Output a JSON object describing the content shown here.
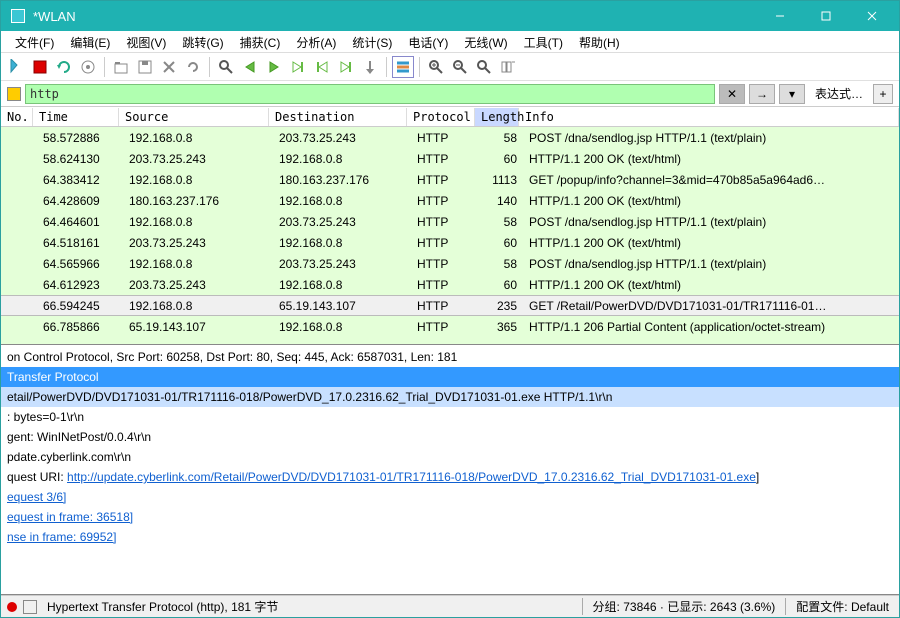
{
  "window": {
    "title": "*WLAN"
  },
  "menu": [
    "文件(F)",
    "编辑(E)",
    "视图(V)",
    "跳转(G)",
    "捕获(C)",
    "分析(A)",
    "统计(S)",
    "电话(Y)",
    "无线(W)",
    "工具(T)",
    "帮助(H)"
  ],
  "filter": {
    "value": "http",
    "expr_label": "表达式…"
  },
  "columns": [
    "No.",
    "Time",
    "Source",
    "Destination",
    "Protocol",
    "Length",
    "Info"
  ],
  "sorted_column": 5,
  "packets": [
    {
      "time": "58.572886",
      "src": "192.168.0.8",
      "dst": "203.73.25.243",
      "proto": "HTTP",
      "len": "58",
      "info": "POST /dna/sendlog.jsp HTTP/1.1  (text/plain)",
      "sel": false
    },
    {
      "time": "58.624130",
      "src": "203.73.25.243",
      "dst": "192.168.0.8",
      "proto": "HTTP",
      "len": "60",
      "info": "HTTP/1.1 200 OK  (text/html)",
      "sel": false
    },
    {
      "time": "64.383412",
      "src": "192.168.0.8",
      "dst": "180.163.237.176",
      "proto": "HTTP",
      "len": "1113",
      "info": "GET /popup/info?channel=3&mid=470b85a5a964ad6…",
      "sel": false
    },
    {
      "time": "64.428609",
      "src": "180.163.237.176",
      "dst": "192.168.0.8",
      "proto": "HTTP",
      "len": "140",
      "info": "HTTP/1.1 200 OK  (text/html)",
      "sel": false
    },
    {
      "time": "64.464601",
      "src": "192.168.0.8",
      "dst": "203.73.25.243",
      "proto": "HTTP",
      "len": "58",
      "info": "POST /dna/sendlog.jsp HTTP/1.1  (text/plain)",
      "sel": false
    },
    {
      "time": "64.518161",
      "src": "203.73.25.243",
      "dst": "192.168.0.8",
      "proto": "HTTP",
      "len": "60",
      "info": "HTTP/1.1 200 OK  (text/html)",
      "sel": false
    },
    {
      "time": "64.565966",
      "src": "192.168.0.8",
      "dst": "203.73.25.243",
      "proto": "HTTP",
      "len": "58",
      "info": "POST /dna/sendlog.jsp HTTP/1.1  (text/plain)",
      "sel": false
    },
    {
      "time": "64.612923",
      "src": "203.73.25.243",
      "dst": "192.168.0.8",
      "proto": "HTTP",
      "len": "60",
      "info": "HTTP/1.1 200 OK  (text/html)",
      "sel": false
    },
    {
      "time": "66.594245",
      "src": "192.168.0.8",
      "dst": "65.19.143.107",
      "proto": "HTTP",
      "len": "235",
      "info": "GET /Retail/PowerDVD/DVD171031-01/TR171116-01…",
      "sel": true
    },
    {
      "time": "66.785866",
      "src": "65.19.143.107",
      "dst": "192.168.0.8",
      "proto": "HTTP",
      "len": "365",
      "info": "HTTP/1.1 206 Partial Content  (application/octet-stream)",
      "sel": false
    }
  ],
  "details": {
    "l0": "on Control Protocol, Src Port: 60258, Dst Port: 80, Seq: 445, Ack: 6587031, Len: 181",
    "l1": "Transfer Protocol",
    "l2": "etail/PowerDVD/DVD171031-01/TR171116-018/PowerDVD_17.0.2316.62_Trial_DVD171031-01.exe HTTP/1.1\\r\\n",
    "l3": ": bytes=0-1\\r\\n",
    "l4": "gent: WinINetPost/0.0.4\\r\\n",
    "l5": "pdate.cyberlink.com\\r\\n",
    "l6": "",
    "l7a": "quest URI: ",
    "l7b": "http://update.cyberlink.com/Retail/PowerDVD/DVD171031-01/TR171116-018/PowerDVD_17.0.2316.62_Trial_DVD171031-01.exe",
    "l7c": "]",
    "l8": "equest 3/6]",
    "l9": "equest in frame: 36518]",
    "l10": "nse in frame: 69952]"
  },
  "status": {
    "proto": "Hypertext Transfer Protocol (http), 181 字节",
    "pkts": "分组: 73846 · 已显示: 2643 (3.6%)",
    "profile": "配置文件: Default"
  }
}
